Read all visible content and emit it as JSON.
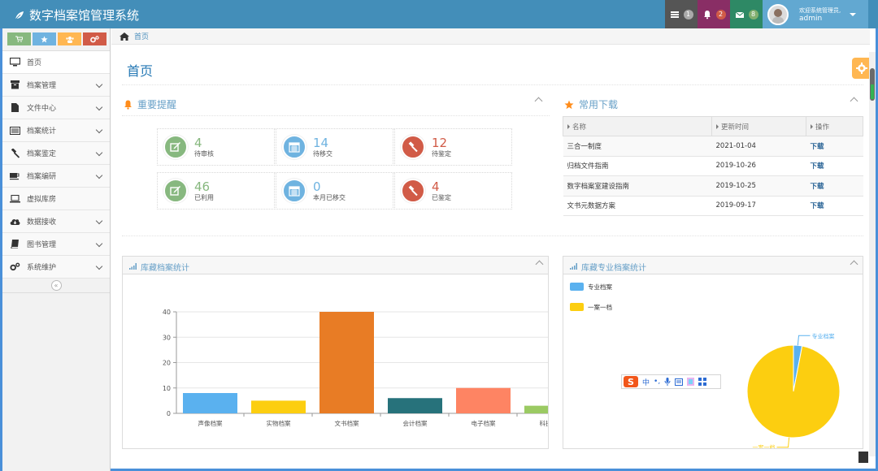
{
  "app": {
    "title": "数字档案馆管理系统"
  },
  "navbar": {
    "tasks_count": "1",
    "notifications_count": "2",
    "messages_count": "8",
    "welcome": "欢迎系统管理员,",
    "username": "admin"
  },
  "sidebar": {
    "items": [
      {
        "label": "首页",
        "icon": "desktop-icon"
      },
      {
        "label": "档案管理",
        "icon": "archive-box-icon"
      },
      {
        "label": "文件中心",
        "icon": "file-icon"
      },
      {
        "label": "档案统计",
        "icon": "list-alt-icon"
      },
      {
        "label": "档案鉴定",
        "icon": "gavel-icon"
      },
      {
        "label": "档案编研",
        "icon": "coffee-icon"
      },
      {
        "label": "虚拟库房",
        "icon": "laptop-icon"
      },
      {
        "label": "数据接收",
        "icon": "cloud-download-icon"
      },
      {
        "label": "图书管理",
        "icon": "book-icon"
      },
      {
        "label": "系统维护",
        "icon": "cogs-icon"
      }
    ],
    "collapse_glyph": "«"
  },
  "breadcrumb": {
    "home": "首页"
  },
  "page": {
    "title": "首页"
  },
  "reminders": {
    "title": "重要提醒",
    "items": [
      {
        "value": "4",
        "label": "待审核",
        "icon": "pencil-square-icon",
        "color": "#87b87f"
      },
      {
        "value": "14",
        "label": "待移交",
        "icon": "calendar-icon",
        "color": "#6fb3e0"
      },
      {
        "value": "12",
        "label": "待鉴定",
        "icon": "gavel-icon",
        "color": "#d15b47"
      },
      {
        "value": "46",
        "label": "已利用",
        "icon": "pencil-square-icon",
        "color": "#87b87f"
      },
      {
        "value": "0",
        "label": "本月已移交",
        "icon": "calendar-icon",
        "color": "#6fb3e0"
      },
      {
        "value": "4",
        "label": "已鉴定",
        "icon": "gavel-icon",
        "color": "#d15b47"
      }
    ]
  },
  "downloads": {
    "title": "常用下载",
    "columns": [
      "名称",
      "更新时间",
      "操作"
    ],
    "rows": [
      {
        "name": "三合一制度",
        "date": "2021-01-04",
        "action": "下载"
      },
      {
        "name": "归档文件指南",
        "date": "2019-10-26",
        "action": "下载"
      },
      {
        "name": "数字档案室建设指南",
        "date": "2019-10-25",
        "action": "下载"
      },
      {
        "name": "文书元数据方案",
        "date": "2019-09-17",
        "action": "下载"
      }
    ]
  },
  "bar_chart_widget": {
    "title": "库藏档案统计"
  },
  "pie_chart_widget": {
    "title": "库藏专业档案统计"
  },
  "chart_data": [
    {
      "type": "bar",
      "title": "",
      "categories": [
        "声像档案",
        "实物档案",
        "文书档案",
        "会计档案",
        "电子档案",
        "科技档案"
      ],
      "values": [
        8,
        5,
        40,
        6,
        10,
        3
      ],
      "colors": [
        "#5ab1ef",
        "#fcce10",
        "#e87c25",
        "#27727b",
        "#fe8463",
        "#9bca63"
      ],
      "ylim": [
        0,
        40
      ],
      "yticks": [
        0,
        10,
        20,
        30,
        40
      ],
      "grid": true,
      "xlabel": "",
      "ylabel": ""
    },
    {
      "type": "pie",
      "title": "",
      "labels": [
        "专业档案",
        "一案一档"
      ],
      "values": [
        3,
        97
      ],
      "colors": [
        "#5ab1ef",
        "#fcce10"
      ],
      "legend": "top-left"
    }
  ],
  "ime": {
    "logo": "S",
    "mode": "中",
    "punct": "•,"
  }
}
